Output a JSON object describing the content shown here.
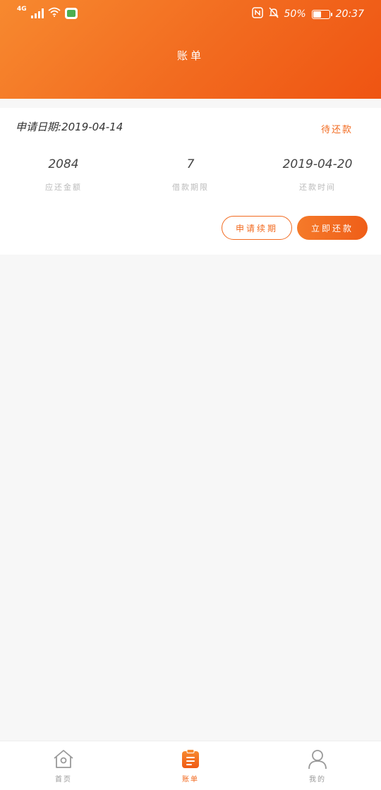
{
  "status_bar": {
    "network": "4G",
    "battery": "50%",
    "battery_level": 0.5,
    "time": "20:37"
  },
  "header": {
    "title": "账单"
  },
  "bill": {
    "apply_date_label": "申请日期:",
    "apply_date": "2019-04-14",
    "status": "待还款",
    "stats": [
      {
        "value": "2084",
        "label": "应还金额"
      },
      {
        "value": "7",
        "label": "借款期限"
      },
      {
        "value": "2019-04-20",
        "label": "还款时间"
      }
    ],
    "buttons": {
      "extend": "申请续期",
      "repay": "立即还款"
    }
  },
  "tabs": [
    {
      "label": "首页",
      "icon": "home-icon",
      "active": false
    },
    {
      "label": "账单",
      "icon": "bill-icon",
      "active": true
    },
    {
      "label": "我的",
      "icon": "user-icon",
      "active": false
    }
  ],
  "colors": {
    "accent": "#f26a1f",
    "inactive": "#999999"
  }
}
